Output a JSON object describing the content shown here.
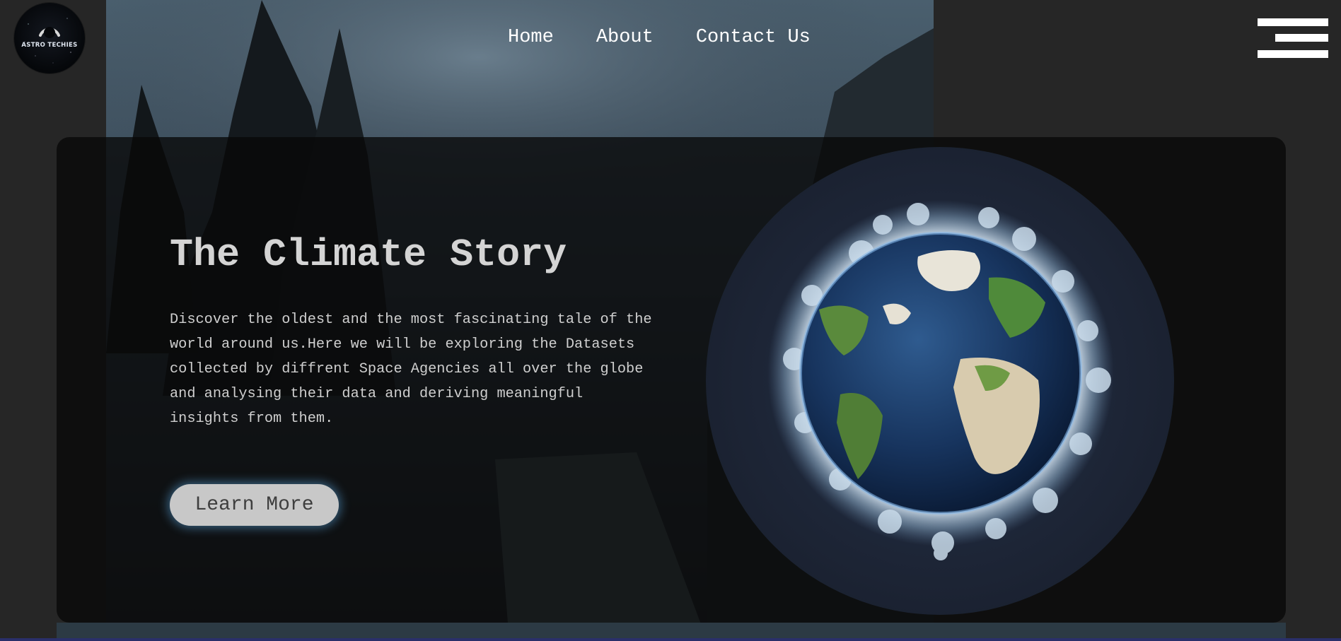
{
  "brand": {
    "logo_text": "ASTRO TECHIES"
  },
  "nav": {
    "items": [
      {
        "label": "Home"
      },
      {
        "label": "About"
      },
      {
        "label": "Contact Us"
      }
    ]
  },
  "hero": {
    "title": "The Climate Story",
    "description": "Discover the oldest and the most fascinating tale of the world around us.Here we will be exploring the Datasets collected by diffrent Space Agencies all over the globe and analysing their data and deriving meaningful insights from them.",
    "cta_label": "Learn More"
  },
  "icons": {
    "menu": "hamburger-menu-icon",
    "logo": "astro-techies-logo"
  },
  "colors": {
    "page_bg": "#262626",
    "card_bg": "#080808",
    "title_text": "#d4d4d4",
    "body_text": "#cfcfcf",
    "button_bg": "#c8c8c8",
    "button_glow": "#69beff",
    "nav_text": "#ffffff"
  }
}
